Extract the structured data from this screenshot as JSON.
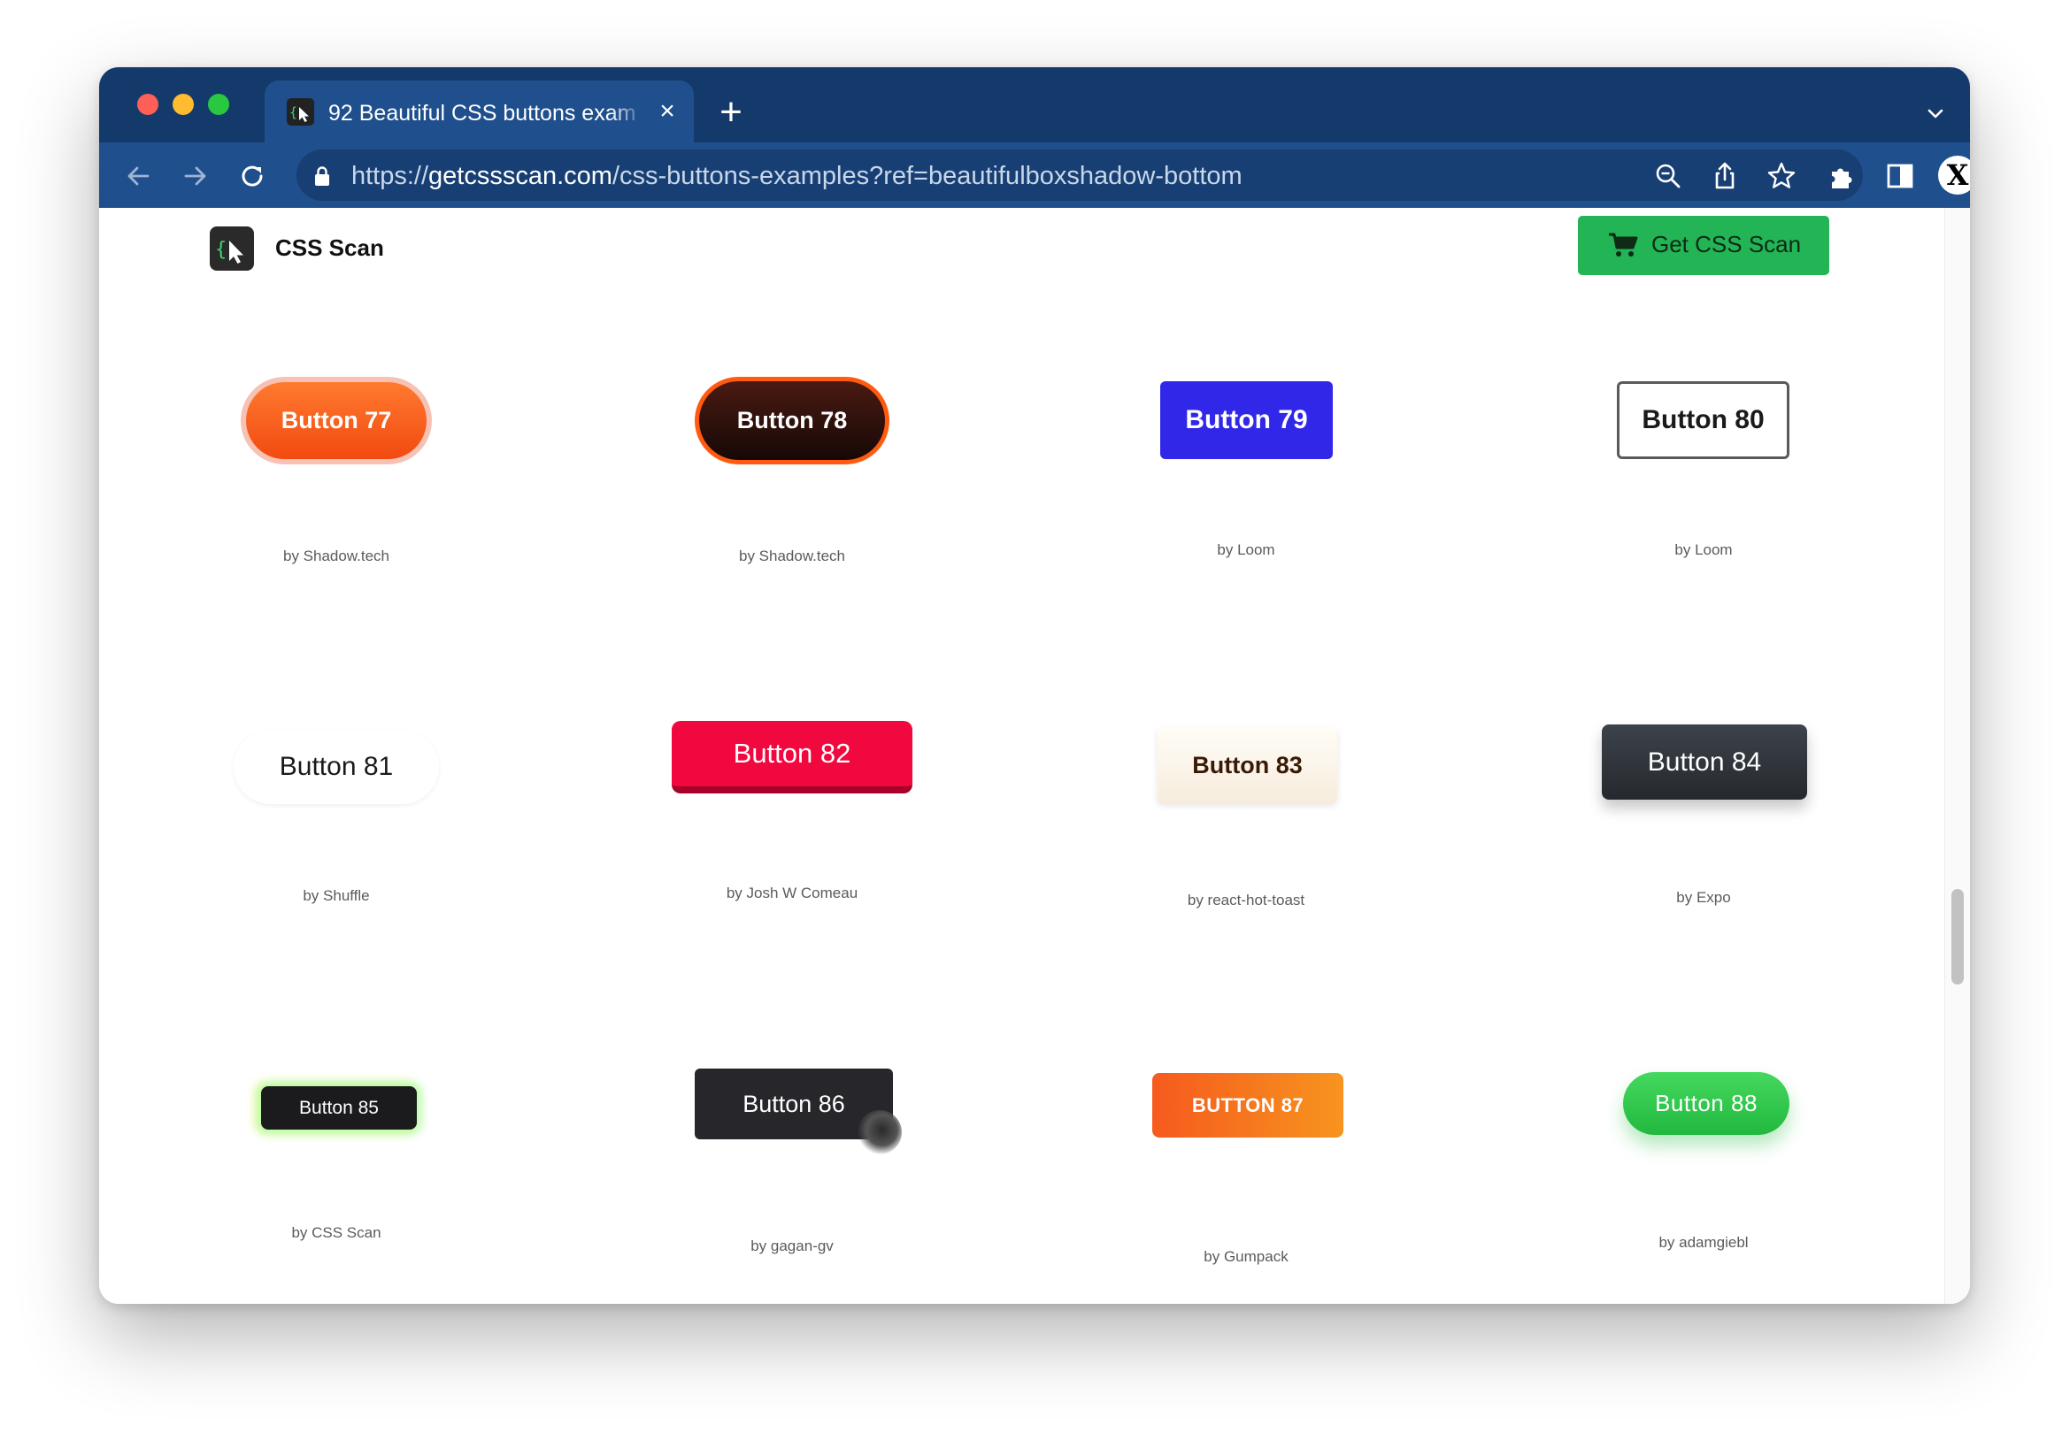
{
  "browser": {
    "tab_title": "92 Beautiful CSS buttons exam",
    "url_scheme": "https://",
    "url_host": "getcssscan.com",
    "url_path": "/css-buttons-examples?ref=beautifulboxshadow-bottom",
    "avatar_letter": "X"
  },
  "site": {
    "brand": "CSS Scan",
    "cta_label": "Get CSS Scan"
  },
  "buttons": [
    {
      "label": "Button 77",
      "credit": "by Shadow.tech"
    },
    {
      "label": "Button 78",
      "credit": "by Shadow.tech"
    },
    {
      "label": "Button 79",
      "credit": "by Loom"
    },
    {
      "label": "Button 80",
      "credit": "by Loom"
    },
    {
      "label": "Button 81",
      "credit": "by Shuffle"
    },
    {
      "label": "Button 82",
      "credit": "by Josh W Comeau"
    },
    {
      "label": "Button 83",
      "credit": "by react-hot-toast"
    },
    {
      "label": "Button 84",
      "credit": "by Expo"
    },
    {
      "label": "Button 85",
      "credit": "by CSS Scan"
    },
    {
      "label": "Button 86",
      "credit": "by gagan-gv"
    },
    {
      "label": "BUTTON 87",
      "credit": "by Gumpack"
    },
    {
      "label": "Button 88",
      "credit": "by adamgiebl"
    }
  ],
  "colors": {
    "tabbar": "#133a6b",
    "toolbar": "#1f4f8c",
    "cta_green": "#22b455"
  },
  "icons": [
    "back-icon",
    "forward-icon",
    "reload-icon",
    "lock-icon",
    "zoom-icon",
    "share-icon",
    "star-icon",
    "extensions-icon",
    "side-panel-icon",
    "menu-icon",
    "cart-icon"
  ]
}
